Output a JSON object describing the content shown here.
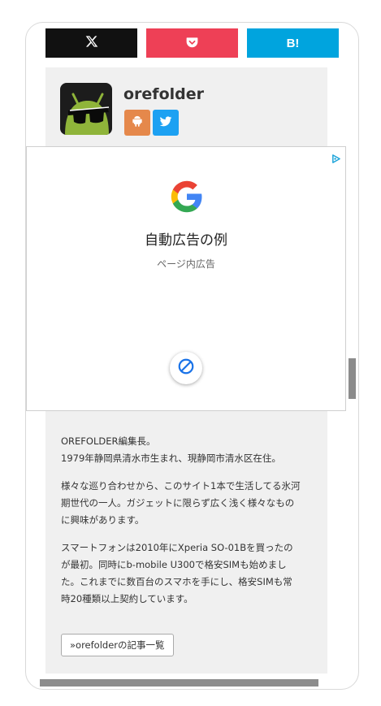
{
  "share": {
    "x_icon": "x-logo-icon",
    "pocket_icon": "pocket-icon",
    "hatena_label": "B!",
    "colors": {
      "x": "#111111",
      "pocket": "#ee4056",
      "hatena": "#00a4de"
    }
  },
  "author": {
    "name": "orefolder",
    "avatar_icon": "android-sunglasses-avatar",
    "social": [
      {
        "icon": "feedly-android-icon",
        "color": "#e5884b"
      },
      {
        "icon": "twitter-bird-icon",
        "color": "#1da1f2"
      }
    ]
  },
  "ad": {
    "title": "自動広告の例",
    "subtitle": "ページ内広告",
    "choices_icon": "adchoices-icon",
    "logo_icon": "google-g-logo",
    "block_icon": "block-ad-icon"
  },
  "bio": {
    "p1_line1": "OREFOLDER編集長。",
    "p1_line2": "1979年静岡県清水市生まれ、現静岡市清水区在住。",
    "p2_line1": "様々な巡り合わせから、このサイト1本で生活してる氷河",
    "p2_line2": "期世代の一人。ガジェットに限らず広く浅く様々なもの",
    "p2_line3": "に興味があります。",
    "p3_line1": "スマートフォンは2010年にXperia SO-01Bを買ったの",
    "p3_line2": "が最初。同時にb-mobile U300で格安SIMも始めまし",
    "p3_line3": "た。これまでに数百台のスマホを手にし、格安SIMも常",
    "p3_line4": "時20種類以上契約しています。"
  },
  "posts_button": "»orefolderの記事一覧"
}
